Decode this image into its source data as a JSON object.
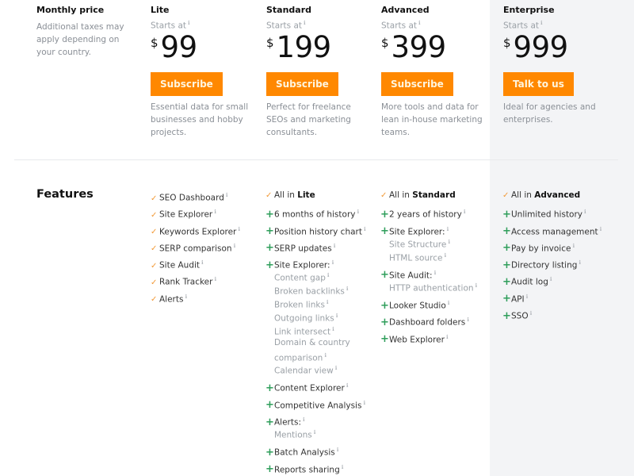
{
  "colors": {
    "accent": "#ff8800",
    "check": "#f29a38",
    "plus": "#2f9e5b",
    "enterprise_bg": "#f3f4f6",
    "muted_text": "#8a8f96"
  },
  "label_column": {
    "title": "Monthly price",
    "note": "Additional taxes may apply depending on your country."
  },
  "plans": [
    {
      "name": "Lite",
      "starts_at": "Starts at",
      "currency": "$",
      "price": "99",
      "cta": "Subscribe",
      "description": "Essential data for small businesses and hobby projects."
    },
    {
      "name": "Standard",
      "starts_at": "Starts at",
      "currency": "$",
      "price": "199",
      "cta": "Subscribe",
      "description": "Perfect for freelance SEOs and marketing consultants."
    },
    {
      "name": "Advanced",
      "starts_at": "Starts at",
      "currency": "$",
      "price": "399",
      "cta": "Subscribe",
      "description": "More tools and data for lean in-house marketing teams."
    },
    {
      "name": "Enterprise",
      "starts_at": "Starts at",
      "currency": "$",
      "price": "999",
      "cta": "Talk to us",
      "description": "Ideal for agencies and enterprises."
    }
  ],
  "info_glyph": "ℹ",
  "features": {
    "title": "Features",
    "lite": [
      {
        "icon": "check-icon",
        "label": "SEO Dashboard"
      },
      {
        "icon": "check-icon",
        "label": "Site Explorer"
      },
      {
        "icon": "check-icon",
        "label": "Keywords Explorer"
      },
      {
        "icon": "check-icon",
        "label": "SERP comparison"
      },
      {
        "icon": "check-icon",
        "label": "Site Audit"
      },
      {
        "icon": "check-icon",
        "label": "Rank Tracker"
      },
      {
        "icon": "check-icon",
        "label": "Alerts"
      }
    ],
    "standard": {
      "all_in_prefix": "All in",
      "all_in_plan": "Lite",
      "items": [
        {
          "label": "6 months of history"
        },
        {
          "label": "Position history chart"
        },
        {
          "label": "SERP updates"
        },
        {
          "label": "Site Explorer:",
          "subs": [
            "Content gap",
            "Broken backlinks",
            "Broken links",
            "Outgoing links",
            "Link intersect",
            "Domain & country comparison",
            "Calendar view"
          ]
        },
        {
          "label": "Content Explorer"
        },
        {
          "label": "Competitive Analysis"
        },
        {
          "label": "Alerts:",
          "subs": [
            "Mentions"
          ]
        },
        {
          "label": "Batch Analysis"
        },
        {
          "label": "Reports sharing"
        }
      ]
    },
    "advanced": {
      "all_in_prefix": "All in",
      "all_in_plan": "Standard",
      "items": [
        {
          "label": "2 years of history"
        },
        {
          "label": "Site Explorer:",
          "subs": [
            "Site Structure",
            "HTML source"
          ]
        },
        {
          "label": "Site Audit:",
          "subs": [
            "HTTP authentication"
          ]
        },
        {
          "label": "Looker Studio"
        },
        {
          "label": "Dashboard folders"
        },
        {
          "label": "Web Explorer"
        }
      ]
    },
    "enterprise": {
      "all_in_prefix": "All in",
      "all_in_plan": "Advanced",
      "items": [
        {
          "label": "Unlimited history"
        },
        {
          "label": "Access management"
        },
        {
          "label": "Pay by invoice"
        },
        {
          "label": "Directory listing"
        },
        {
          "label": "Audit log"
        },
        {
          "label": "API"
        },
        {
          "label": "SSO"
        }
      ]
    }
  }
}
